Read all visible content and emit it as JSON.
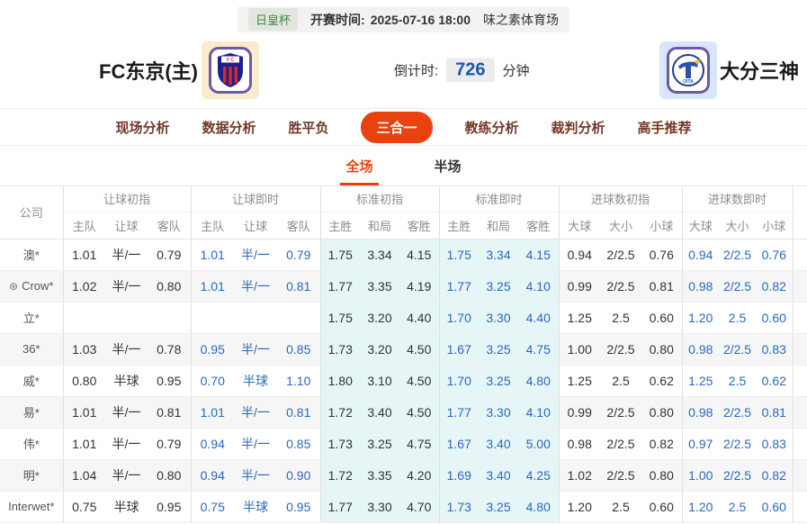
{
  "top_bar": {
    "league_badge": "日皇杯",
    "kickoff_label": "开赛时间:",
    "kickoff_time": "2025-07-16 18:00",
    "venue": "味之素体育场"
  },
  "header": {
    "home_team": "FC东京(主)",
    "away_team": "大分三神",
    "countdown_label": "倒计时:",
    "countdown_value": "726",
    "countdown_unit": "分钟"
  },
  "nav_tabs": [
    {
      "label": "现场分析",
      "active": false
    },
    {
      "label": "数据分析",
      "active": false
    },
    {
      "label": "胜平负",
      "active": false
    },
    {
      "label": "三合一",
      "active": true
    },
    {
      "label": "教练分析",
      "active": false
    },
    {
      "label": "裁判分析",
      "active": false
    },
    {
      "label": "高手推荐",
      "active": false
    }
  ],
  "sub_tabs": [
    {
      "label": "全场",
      "active": true
    },
    {
      "label": "半场",
      "active": false
    }
  ],
  "icons": {
    "soccer_ball": "⊛"
  },
  "colors": {
    "accent_orange": "#e8430e",
    "live_blue": "#2a68c1",
    "countdown_blue": "#1c55b8",
    "badge_green": "#3d8b40",
    "highlight_cyan": "#e6f5f5",
    "stripe_gray": "#f6f6f6",
    "logo_border_purple": "#6a5aa8",
    "home_logo_bg": "#fbeacb",
    "away_logo_bg": "#d8e6fa"
  },
  "odds_table": {
    "company_header": "公司",
    "groups": [
      {
        "label": "让球初指",
        "cols": [
          "主队",
          "让球",
          "客队"
        ],
        "live": false,
        "highlight": false
      },
      {
        "label": "让球即时",
        "cols": [
          "主队",
          "让球",
          "客队"
        ],
        "live": true,
        "highlight": false
      },
      {
        "label": "标准初指",
        "cols": [
          "主胜",
          "和局",
          "客胜"
        ],
        "live": false,
        "highlight": true
      },
      {
        "label": "标准即时",
        "cols": [
          "主胜",
          "和局",
          "客胜"
        ],
        "live": true,
        "highlight": true
      },
      {
        "label": "进球数初指",
        "cols": [
          "大球",
          "大小",
          "小球"
        ],
        "live": false,
        "highlight": false
      },
      {
        "label": "进球数即时",
        "cols": [
          "大球",
          "大小",
          "小球"
        ],
        "live": true,
        "highlight": false
      }
    ],
    "rows": [
      {
        "company": "澳*",
        "icon": false,
        "cells": [
          [
            "1.01",
            "半/一",
            "0.79"
          ],
          [
            "1.01",
            "半/一",
            "0.79"
          ],
          [
            "1.75",
            "3.34",
            "4.15"
          ],
          [
            "1.75",
            "3.34",
            "4.15"
          ],
          [
            "0.94",
            "2/2.5",
            "0.76"
          ],
          [
            "0.94",
            "2/2.5",
            "0.76"
          ]
        ]
      },
      {
        "company": "Crow*",
        "icon": true,
        "cells": [
          [
            "1.02",
            "半/一",
            "0.80"
          ],
          [
            "1.01",
            "半/一",
            "0.81"
          ],
          [
            "1.77",
            "3.35",
            "4.19"
          ],
          [
            "1.77",
            "3.25",
            "4.10"
          ],
          [
            "0.99",
            "2/2.5",
            "0.81"
          ],
          [
            "0.98",
            "2/2.5",
            "0.82"
          ]
        ]
      },
      {
        "company": "立*",
        "icon": false,
        "cells": [
          [
            "",
            "",
            ""
          ],
          [
            "",
            "",
            ""
          ],
          [
            "1.75",
            "3.20",
            "4.40"
          ],
          [
            "1.70",
            "3.30",
            "4.40"
          ],
          [
            "1.25",
            "2.5",
            "0.60"
          ],
          [
            "1.20",
            "2.5",
            "0.60"
          ]
        ]
      },
      {
        "company": "36*",
        "icon": false,
        "cells": [
          [
            "1.03",
            "半/一",
            "0.78"
          ],
          [
            "0.95",
            "半/一",
            "0.85"
          ],
          [
            "1.73",
            "3.20",
            "4.50"
          ],
          [
            "1.67",
            "3.25",
            "4.75"
          ],
          [
            "1.00",
            "2/2.5",
            "0.80"
          ],
          [
            "0.98",
            "2/2.5",
            "0.83"
          ]
        ]
      },
      {
        "company": "威*",
        "icon": false,
        "cells": [
          [
            "0.80",
            "半球",
            "0.95"
          ],
          [
            "0.70",
            "半球",
            "1.10"
          ],
          [
            "1.80",
            "3.10",
            "4.50"
          ],
          [
            "1.70",
            "3.25",
            "4.80"
          ],
          [
            "1.25",
            "2.5",
            "0.62"
          ],
          [
            "1.25",
            "2.5",
            "0.62"
          ]
        ]
      },
      {
        "company": "易*",
        "icon": false,
        "cells": [
          [
            "1.01",
            "半/一",
            "0.81"
          ],
          [
            "1.01",
            "半/一",
            "0.81"
          ],
          [
            "1.72",
            "3.40",
            "4.50"
          ],
          [
            "1.77",
            "3.30",
            "4.10"
          ],
          [
            "0.99",
            "2/2.5",
            "0.80"
          ],
          [
            "0.98",
            "2/2.5",
            "0.81"
          ]
        ]
      },
      {
        "company": "伟*",
        "icon": false,
        "cells": [
          [
            "1.01",
            "半/一",
            "0.79"
          ],
          [
            "0.94",
            "半/一",
            "0.85"
          ],
          [
            "1.73",
            "3.25",
            "4.75"
          ],
          [
            "1.67",
            "3.40",
            "5.00"
          ],
          [
            "0.98",
            "2/2.5",
            "0.82"
          ],
          [
            "0.97",
            "2/2.5",
            "0.83"
          ]
        ]
      },
      {
        "company": "明*",
        "icon": false,
        "cells": [
          [
            "1.04",
            "半/一",
            "0.80"
          ],
          [
            "0.94",
            "半/一",
            "0.90"
          ],
          [
            "1.72",
            "3.35",
            "4.20"
          ],
          [
            "1.69",
            "3.40",
            "4.25"
          ],
          [
            "1.02",
            "2/2.5",
            "0.80"
          ],
          [
            "1.00",
            "2/2.5",
            "0.82"
          ]
        ]
      },
      {
        "company": "Interwet*",
        "icon": false,
        "cells": [
          [
            "0.75",
            "半球",
            "0.95"
          ],
          [
            "0.75",
            "半球",
            "0.95"
          ],
          [
            "1.77",
            "3.30",
            "4.70"
          ],
          [
            "1.73",
            "3.25",
            "4.80"
          ],
          [
            "1.20",
            "2.5",
            "0.60"
          ],
          [
            "1.20",
            "2.5",
            "0.60"
          ]
        ]
      }
    ]
  }
}
